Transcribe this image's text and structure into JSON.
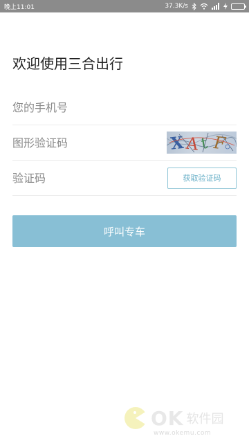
{
  "status_bar": {
    "time": "晚上11:01",
    "network_speed": "37.3K/s",
    "icons": [
      "bluetooth-icon",
      "wifi-icon",
      "signal-icon",
      "charging-icon",
      "battery-icon"
    ],
    "battery_color": "#5bd25b"
  },
  "page": {
    "title": "欢迎使用三合出行"
  },
  "form": {
    "phone_placeholder": "您的手机号",
    "captcha_placeholder": "图形验证码",
    "captcha_text": "XAtF",
    "sms_code_placeholder": "验证码",
    "get_code_label": "获取验证码",
    "submit_label": "呼叫专车"
  },
  "watermark": {
    "brand": "OK",
    "name": "软件园",
    "url": "www.okemu.com"
  },
  "colors": {
    "status_bar_bg": "#8b8b8b",
    "accent": "#88bfd5",
    "button_border": "#8fc5d6",
    "button_text": "#6ab0c8",
    "divider": "#ececec"
  }
}
